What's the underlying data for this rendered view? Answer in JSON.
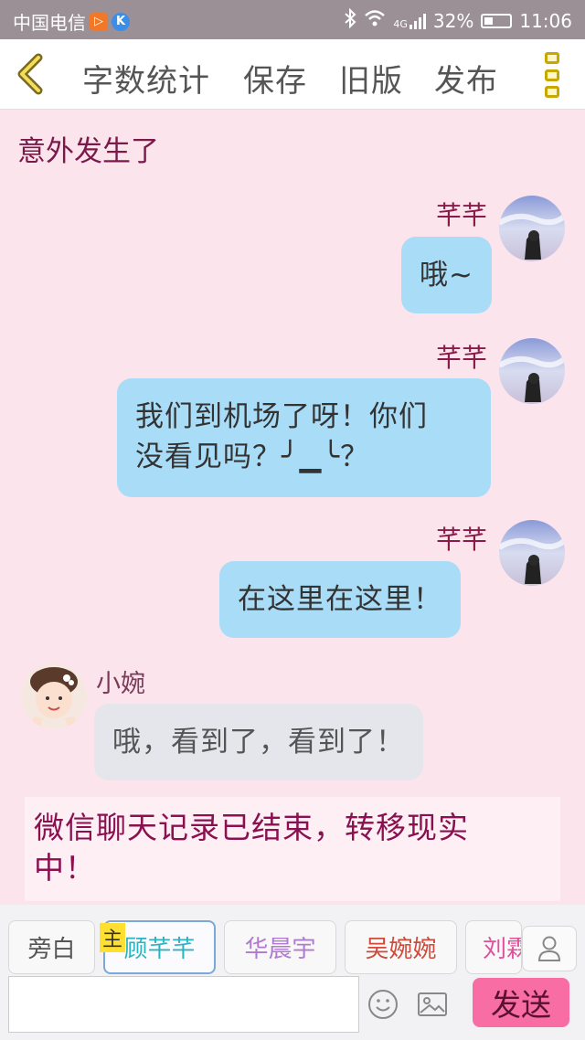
{
  "status_bar": {
    "carrier": "中国电信",
    "icons": [
      "play-app-icon",
      "k-app-icon",
      "bluetooth-icon",
      "wifi-icon",
      "signal-icon",
      "battery-icon"
    ],
    "network": "4G",
    "battery": "32%",
    "time": "11:06"
  },
  "toolbar": {
    "back_icon": "chevron-left-icon",
    "word_count": "字数统计",
    "save": "保存",
    "old_version": "旧版",
    "publish": "发布",
    "menu_icon": "more-vertical-icon"
  },
  "chat": {
    "scene_title": "意外发生了",
    "messages": [
      {
        "speaker": "芊芊",
        "text": "哦~"
      },
      {
        "speaker": "芊芊",
        "text_line1": "我们到机场了呀！你们",
        "text_line2": "没看见吗？╯▁╰？"
      },
      {
        "speaker": "芊芊",
        "text": "在这里在这里！"
      },
      {
        "speaker": "小婉",
        "text": "哦，看到了，看到了！"
      }
    ],
    "end_note_line1": "微信聊天记录已结束，转移现实",
    "end_note_line2": "中！"
  },
  "bottom": {
    "characters": [
      {
        "name": "旁白",
        "color": "#555555"
      },
      {
        "name": "顾芊芊",
        "color": "#2bb3c0"
      },
      {
        "name": "华晨宇",
        "color": "#b07ad0"
      },
      {
        "name": "吴婉婉",
        "color": "#d04a3a"
      },
      {
        "name": "刘霖",
        "color": "#e0509a"
      }
    ],
    "host_badge": "主",
    "input_placeholder": "",
    "send": "发送"
  },
  "colors": {
    "background": "#fce4ec",
    "bubble_blue": "#a8dcf7",
    "bubble_gray": "#e5e6ec",
    "send_button": "#f76da4"
  }
}
